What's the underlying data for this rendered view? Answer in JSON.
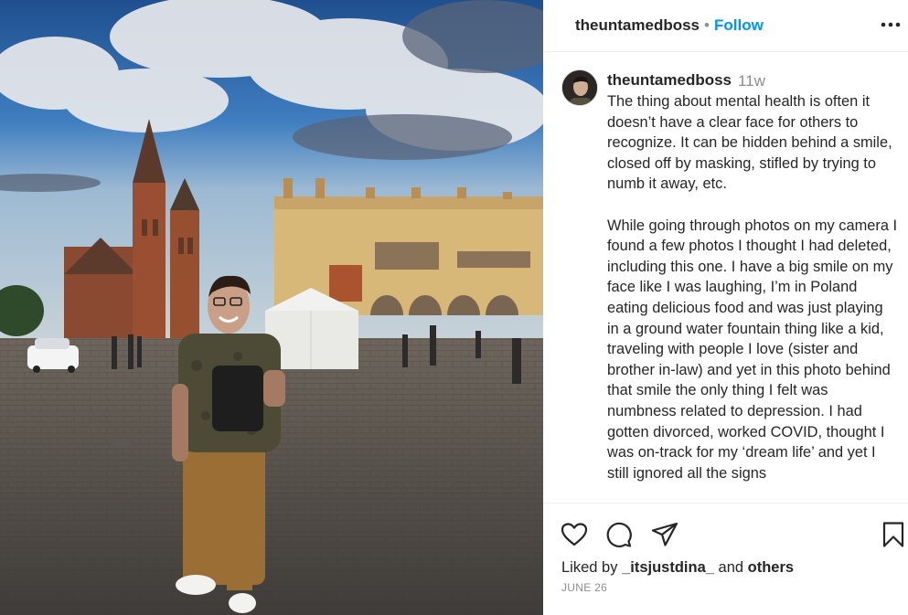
{
  "post": {
    "username": "theuntamedboss",
    "dot": "•",
    "follow_label": "Follow",
    "more_label": "More options",
    "photo_alt": "Person smiling in Kraków main market square"
  },
  "caption": {
    "username": "theuntamedboss",
    "time_ago": "11w",
    "paragraphs": [
      "The thing about mental health is often it doesn’t have a clear face for others to recognize. It can be hidden behind a smile, closed off by masking, stifled by trying to numb it away, etc.",
      "While going through photos on my camera I found a few photos I thought I had deleted, including this one. I have a big smile on my face like I was laughing, I’m in Poland eating delicious food and was just playing in a ground water fountain thing like a kid, traveling with people I love (sister and brother in-law) and yet in this photo behind that smile the only thing I felt was numbness related to depression. I had gotten divorced, worked COVID, thought I was on-track for my ‘dream life’ and yet I still ignored all the signs"
    ]
  },
  "actions": {
    "icons": [
      "heart-icon",
      "comment-icon",
      "share-icon",
      "bookmark-icon"
    ]
  },
  "likes": {
    "prefix": "Liked by",
    "user": "_itsjustdina_",
    "joiner": "and",
    "others": "others"
  },
  "date": "JUNE 26"
}
